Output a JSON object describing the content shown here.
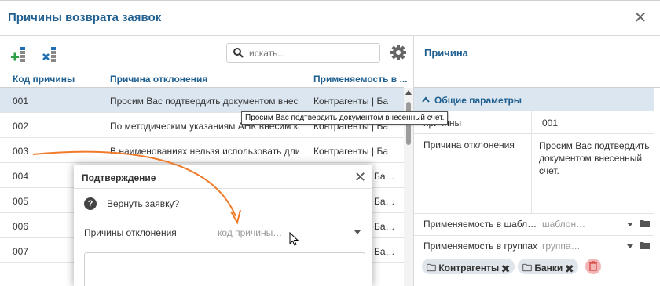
{
  "window": {
    "title": "Причины возврата заявок"
  },
  "toolbar": {
    "search_placeholder": "искать..."
  },
  "table": {
    "headers": [
      "Код причины",
      "Причина отклонения",
      "Применяемость в ..."
    ],
    "rows": [
      {
        "code": "001",
        "reason": "Просим Вас подтвердить документом внес…",
        "applicability": "Контрагенты | Ба…",
        "selected": true
      },
      {
        "code": "002",
        "reason": "По методическим указаниям АНК внесим ка…",
        "applicability": "Контрагенты | Ба…"
      },
      {
        "code": "003",
        "reason": "В наименованиях нельзя использовать дли…",
        "applicability": "Контрагенты | Ба…"
      },
      {
        "code": "004",
        "applicability": "Ба…"
      },
      {
        "code": "005",
        "applicability": "Ба…"
      },
      {
        "code": "006",
        "applicability": "Ба…"
      },
      {
        "code": "007",
        "applicability": "Ба…"
      }
    ]
  },
  "tooltip": "Просим Вас подтвердить документом внесенный счет.",
  "right_panel": {
    "title": "Причина",
    "section": "Общие параметры",
    "props": {
      "code_key": "причины",
      "code_val": "001",
      "reason_key": "Причина отклонения",
      "reason_val": "Просим Вас подтвердить документом внесенный счет.",
      "tmpl_key": "Применяемость в шабл…",
      "tmpl_placeholder": "шаблон…",
      "groups_key": "Применяемость в группах",
      "groups_placeholder": "группа…"
    },
    "tags": [
      "Контрагенты",
      "Банки"
    ]
  },
  "dialog": {
    "title": "Подтверждение",
    "question": "Вернуть заявку?",
    "field_label": "Причины отклонения",
    "field_placeholder": "код причины…"
  },
  "colors": {
    "accent": "#1f5f8f",
    "selection": "#dbe6f0",
    "toolbar_green": "#2e9e44",
    "toolbar_blue": "#1f6fb2",
    "arrow": "#f07b2a",
    "trash_bg": "#f2b6b6"
  },
  "icons": [
    "add-icon",
    "delete-icon",
    "search-icon",
    "gear-icon",
    "close-icon",
    "chevron-up-icon",
    "folder-icon",
    "question-icon",
    "mouse-cursor-icon",
    "trash-icon"
  ]
}
